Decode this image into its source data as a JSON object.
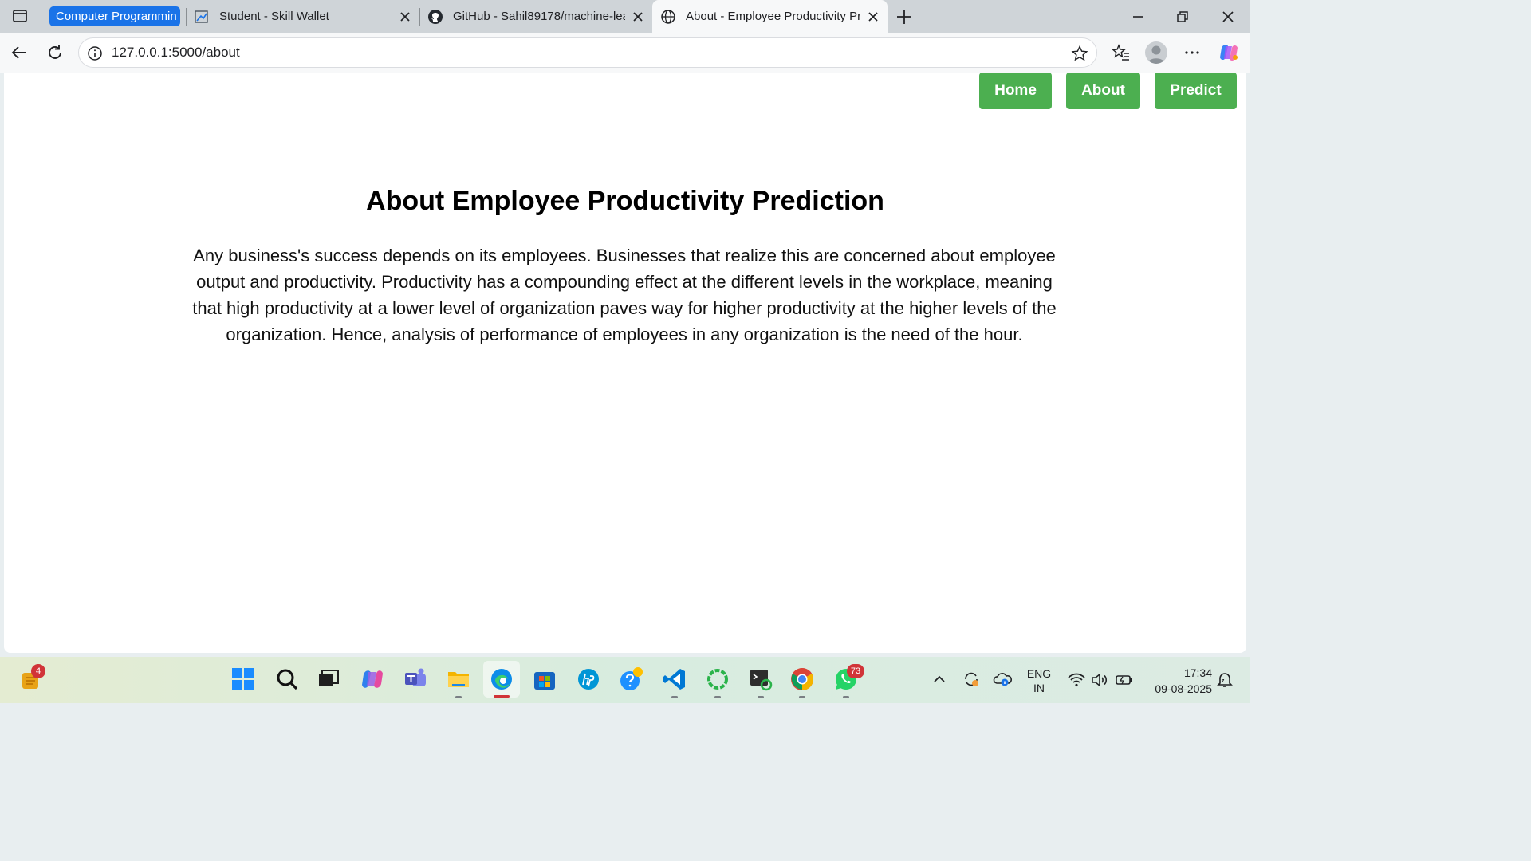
{
  "browser": {
    "tab_group_label": "Computer Programmin",
    "tabs": [
      {
        "title": "Student - Skill Wallet",
        "icon": "skill-wallet-icon"
      },
      {
        "title": "GitHub - Sahil89178/machine-lea",
        "icon": "github-icon"
      },
      {
        "title": "About - Employee Productivity Pr",
        "icon": "globe-icon",
        "active": true
      }
    ],
    "url": "127.0.0.1:5000/about"
  },
  "page": {
    "nav": [
      "Home",
      "About",
      "Predict"
    ],
    "title": "About Employee Productivity Prediction",
    "body": "Any business's success depends on its employees. Businesses that realize this are concerned about employee output and productivity. Productivity has a compounding effect at the different levels in the workplace, meaning that high productivity at a lower level of organization paves way for higher productivity at the higher levels of the organization. Hence, analysis of performance of employees in any organization is the need of the hour."
  },
  "taskbar": {
    "widgets_badge": "4",
    "whatsapp_badge": "73",
    "language": "ENG",
    "region": "IN",
    "time": "17:34",
    "date": "09-08-2025"
  },
  "colors": {
    "nav_button": "#4caf50",
    "tab_group": "#1a73e8"
  }
}
